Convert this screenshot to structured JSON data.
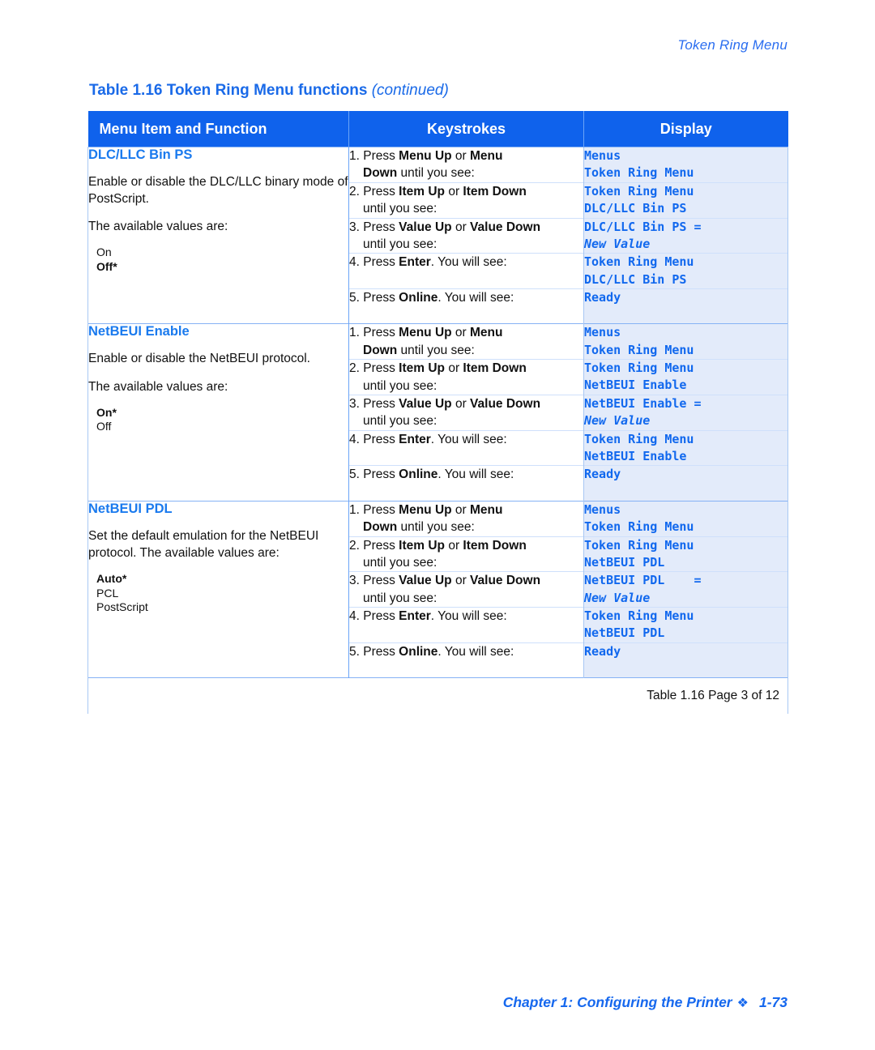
{
  "running_head": "Token Ring Menu",
  "caption": {
    "main": "Table 1.16  Token Ring Menu functions ",
    "continued": "(continued)"
  },
  "colors": {
    "header_blue": "#0f62ec",
    "link_blue": "#1a7aee",
    "display_bg": "#e3ebfa",
    "display_text": "#1168ee"
  },
  "header": {
    "col1": "Menu Item and Function",
    "col2": "Keystrokes",
    "col3": "Display"
  },
  "sections": [
    {
      "title": "DLC/LLC Bin PS",
      "desc1": "Enable or disable the DLC/LLC binary mode of PostScript.",
      "desc2": "The available values are:",
      "values": [
        {
          "label": "On",
          "default": false
        },
        {
          "label": "Off*",
          "default": true
        }
      ],
      "steps": [
        {
          "num": "1.",
          "pre": "Press ",
          "b1": "Menu Up",
          "mid": " or ",
          "b2": "Menu",
          "line2_b": "Down",
          "line2_t": " until you see:",
          "display1": "Menus",
          "display1_italic": false,
          "display2": "Token Ring Menu",
          "display2_italic": false
        },
        {
          "num": "2.",
          "pre": "Press ",
          "b1": "Item Up",
          "mid": " or ",
          "b2": "Item Down",
          "line2_b": "",
          "line2_t": "until you see:",
          "display1": "Token Ring Menu",
          "display1_italic": false,
          "display2": "DLC/LLC Bin PS",
          "display2_italic": false
        },
        {
          "num": "3.",
          "pre": "Press ",
          "b1": "Value Up",
          "mid": " or ",
          "b2": "Value Down",
          "line2_b": "",
          "line2_t": "until you see:",
          "display1": "DLC/LLC Bin PS =",
          "display1_italic": false,
          "display2": "New Value",
          "display2_italic": true
        },
        {
          "num": "4.",
          "pre": "Press ",
          "b1": "Enter",
          "mid": ". You will see:",
          "b2": "",
          "line2_b": "",
          "line2_t": "",
          "display1": "Token Ring Menu",
          "display1_italic": false,
          "display2": "DLC/LLC Bin PS",
          "display2_italic": false
        },
        {
          "num": "5.",
          "pre": "Press ",
          "b1": "Online",
          "mid": ". You will see:",
          "b2": "",
          "line2_b": "",
          "line2_t": "",
          "display1": "Ready",
          "display1_italic": false,
          "display2": "",
          "display2_italic": false
        }
      ]
    },
    {
      "title": "NetBEUI Enable",
      "desc1": "Enable or disable the NetBEUI protocol.",
      "desc2": "The available values are:",
      "values": [
        {
          "label": "On*",
          "default": true
        },
        {
          "label": "Off",
          "default": false
        }
      ],
      "steps": [
        {
          "num": "1.",
          "pre": "Press ",
          "b1": "Menu Up",
          "mid": " or ",
          "b2": "Menu",
          "line2_b": "Down",
          "line2_t": " until you see:",
          "display1": "Menus",
          "display1_italic": false,
          "display2": "Token Ring Menu",
          "display2_italic": false
        },
        {
          "num": "2.",
          "pre": "Press ",
          "b1": "Item Up",
          "mid": " or ",
          "b2": "Item Down",
          "line2_b": "",
          "line2_t": "until you see:",
          "display1": "Token Ring Menu",
          "display1_italic": false,
          "display2": "NetBEUI Enable",
          "display2_italic": false
        },
        {
          "num": "3.",
          "pre": "Press ",
          "b1": "Value Up",
          "mid": " or ",
          "b2": "Value Down",
          "line2_b": "",
          "line2_t": "until you see:",
          "display1": "NetBEUI Enable =",
          "display1_italic": false,
          "display2": "New Value",
          "display2_italic": true
        },
        {
          "num": "4.",
          "pre": "Press ",
          "b1": "Enter",
          "mid": ". You will see:",
          "b2": "",
          "line2_b": "",
          "line2_t": "",
          "display1": "Token Ring Menu",
          "display1_italic": false,
          "display2": "NetBEUI Enable",
          "display2_italic": false
        },
        {
          "num": "5.",
          "pre": "Press ",
          "b1": "Online",
          "mid": ". You will see:",
          "b2": "",
          "line2_b": "",
          "line2_t": "",
          "display1": "Ready",
          "display1_italic": false,
          "display2": "",
          "display2_italic": false
        }
      ]
    },
    {
      "title": "NetBEUI PDL",
      "desc1": "Set the default emulation for the NetBEUI protocol. The available values are:",
      "desc2": "",
      "values": [
        {
          "label": "Auto*",
          "default": true
        },
        {
          "label": "PCL",
          "default": false
        },
        {
          "label": "PostScript",
          "default": false
        }
      ],
      "steps": [
        {
          "num": "1.",
          "pre": "Press ",
          "b1": "Menu Up",
          "mid": " or ",
          "b2": "Menu",
          "line2_b": "Down",
          "line2_t": " until you see:",
          "display1": "Menus",
          "display1_italic": false,
          "display2": "Token Ring Menu",
          "display2_italic": false
        },
        {
          "num": "2.",
          "pre": "Press ",
          "b1": "Item Up",
          "mid": " or ",
          "b2": "Item Down",
          "line2_b": "",
          "line2_t": "until you see:",
          "display1": "Token Ring Menu",
          "display1_italic": false,
          "display2": "NetBEUI PDL",
          "display2_italic": false
        },
        {
          "num": "3.",
          "pre": "Press ",
          "b1": "Value Up",
          "mid": " or ",
          "b2": "Value Down",
          "line2_b": "",
          "line2_t": "until you see:",
          "display1": "NetBEUI PDL    =",
          "display1_italic": false,
          "display2": "New Value",
          "display2_italic": true
        },
        {
          "num": "4.",
          "pre": "Press ",
          "b1": "Enter",
          "mid": ". You will see:",
          "b2": "",
          "line2_b": "",
          "line2_t": "",
          "display1": "Token Ring Menu",
          "display1_italic": false,
          "display2": "NetBEUI PDL",
          "display2_italic": false
        },
        {
          "num": "5.",
          "pre": "Press ",
          "b1": "Online",
          "mid": ". You will see:",
          "b2": "",
          "line2_b": "",
          "line2_t": "",
          "display1": "Ready",
          "display1_italic": false,
          "display2": "",
          "display2_italic": false
        }
      ]
    }
  ],
  "table_footnote": "Table 1.16  Page 3 of 12",
  "page_footer": {
    "chapter": "Chapter 1: Configuring the Printer",
    "diamond": "❖",
    "page": "1-73"
  }
}
